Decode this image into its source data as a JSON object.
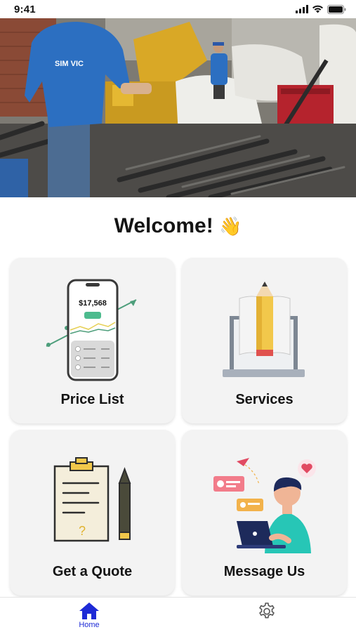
{
  "status_bar": {
    "time": "9:41"
  },
  "hero": {
    "shirt_text": "SIM VIC"
  },
  "welcome": {
    "title": "Welcome!",
    "emoji": "👋"
  },
  "cards": [
    {
      "label": "Price List",
      "icon": "phone-price-chart-icon",
      "price": "$17,568"
    },
    {
      "label": "Services",
      "icon": "laptop-book-pencil-icon"
    },
    {
      "label": "Get a Quote",
      "icon": "clipboard-pencil-icon"
    },
    {
      "label": "Message Us",
      "icon": "person-laptop-chat-icon"
    }
  ],
  "tabbar": {
    "home": {
      "label": "Home",
      "icon": "home-icon"
    },
    "settings": {
      "icon": "gear-icon"
    }
  },
  "colors": {
    "accent": "#1d2ad6",
    "card_bg": "#f3f3f3"
  }
}
